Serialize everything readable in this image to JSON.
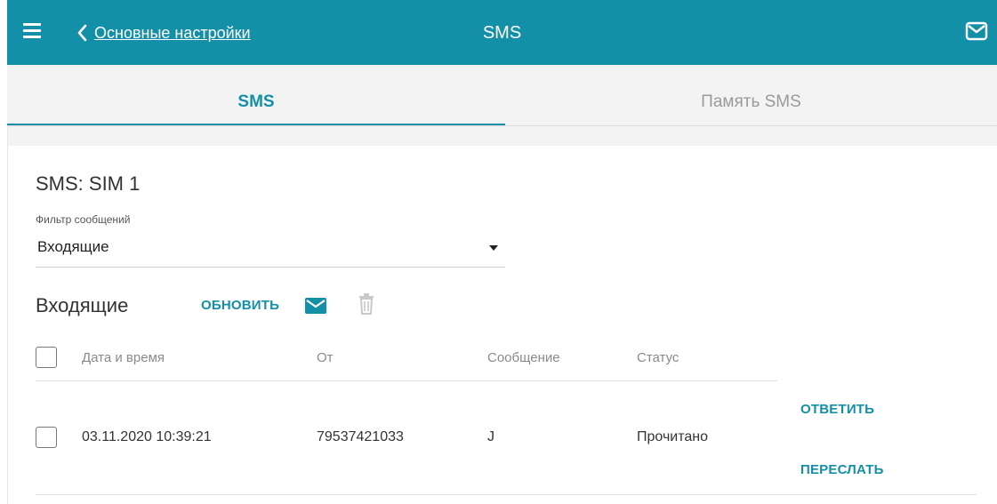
{
  "header": {
    "back_label": "Основные настройки",
    "title": "SMS",
    "icons": {
      "menu": "hamburger-icon",
      "back": "chevron-left-icon",
      "mail": "envelope-icon"
    }
  },
  "tabs": [
    {
      "label": "SMS",
      "active": true
    },
    {
      "label": "Память SMS",
      "active": false
    }
  ],
  "section": {
    "title": "SMS: SIM 1",
    "filter": {
      "label": "Фильтр сообщений",
      "value": "Входящие"
    }
  },
  "list": {
    "title": "Входящие",
    "refresh_label": "ОБНОВИТЬ",
    "icons": {
      "compose": "envelope-icon",
      "delete": "trash-icon"
    },
    "columns": [
      "Дата и время",
      "От",
      "Сообщение",
      "Статус"
    ],
    "rows": [
      {
        "date": "03.11.2020 10:39:21",
        "from": "79537421033",
        "message": "J",
        "status": "Прочитано",
        "actions": [
          "ОТВЕТИТЬ",
          "ПЕРЕСЛАТЬ"
        ]
      }
    ]
  },
  "colors": {
    "accent": "#138fa8",
    "tab_bg": "#f3f3f3",
    "inactive_text": "#9a9a9a"
  }
}
